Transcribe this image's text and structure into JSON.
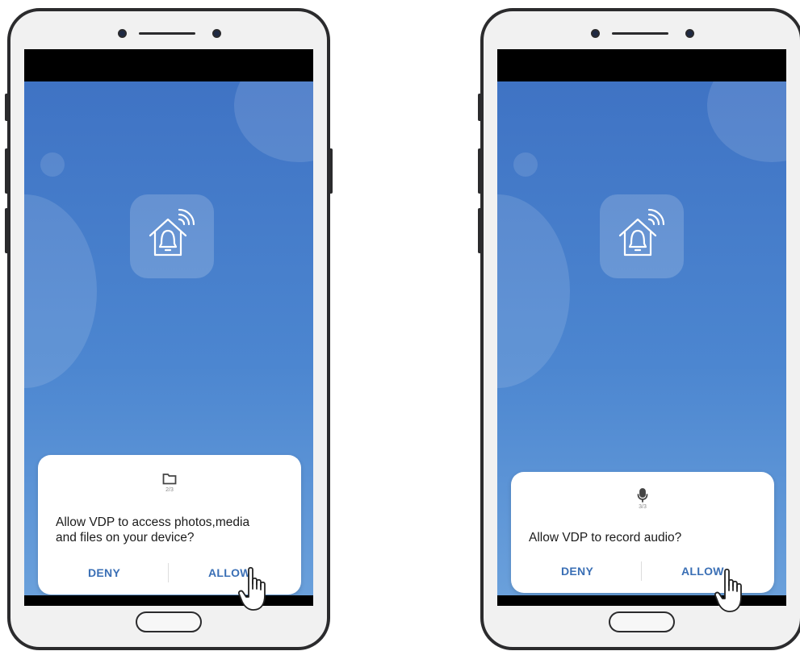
{
  "phones": [
    {
      "dialog": {
        "icon": "folder-icon",
        "counter": "2/3",
        "message_line1": "Allow VDP to access photos,media",
        "message_line2": "and files on your device?",
        "deny_label": "DENY",
        "allow_label": "ALLOW"
      }
    },
    {
      "dialog": {
        "icon": "microphone-icon",
        "counter": "3/3",
        "message_line1": "Allow VDP to record audio?",
        "deny_label": "DENY",
        "allow_label": "ALLOW"
      }
    }
  ],
  "app_icon": "house-bell-wifi-icon",
  "pointer_icon": "hand-pointer-icon",
  "colors": {
    "screen_blue": "#4a82cc",
    "button_text": "#3a6fb5",
    "phone_frame": "#2b2b2d"
  }
}
